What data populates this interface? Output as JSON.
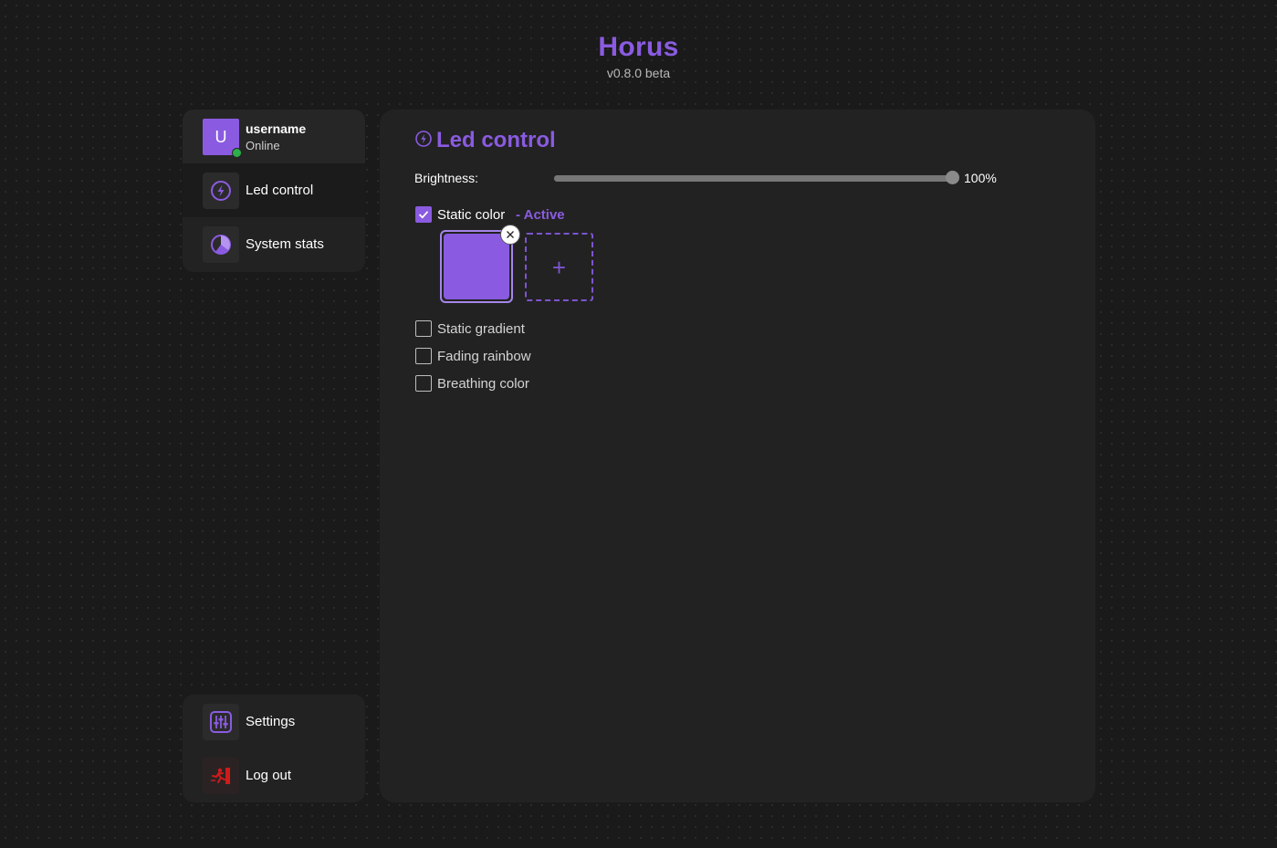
{
  "header": {
    "title": "Horus",
    "version": "v0.8.0 beta"
  },
  "profile": {
    "avatar_letter": "U",
    "username": "username",
    "status": "Online",
    "status_color": "#2bb04a"
  },
  "sidebar": {
    "items": [
      {
        "label": "Led control",
        "icon": "bolt-icon",
        "active": true
      },
      {
        "label": "System stats",
        "icon": "pie-chart-icon",
        "active": false
      }
    ],
    "bottom_items": [
      {
        "label": "Settings",
        "icon": "sliders-icon"
      },
      {
        "label": "Log out",
        "icon": "logout-icon"
      }
    ]
  },
  "main": {
    "title": "Led control",
    "brightness": {
      "label": "Brightness:",
      "value": 1.0,
      "value_text": "100%"
    },
    "modes": [
      {
        "label": "Static color",
        "checked": true,
        "tag": "- Active"
      },
      {
        "label": "Static gradient",
        "checked": false
      },
      {
        "label": "Fading rainbow",
        "checked": false
      },
      {
        "label": "Breathing color",
        "checked": false
      }
    ],
    "colors": [
      "#8a5be0"
    ],
    "add_color_symbol": "+"
  },
  "theme": {
    "accent": "#8a5be0",
    "background": "#1a1a1a",
    "card": "#222222",
    "logout_red": "#d11a1a"
  }
}
